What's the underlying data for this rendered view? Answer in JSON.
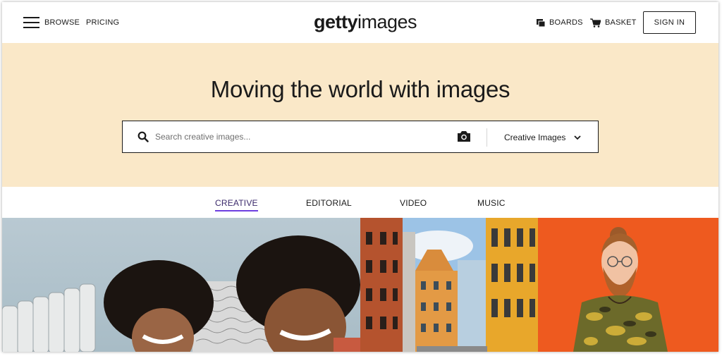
{
  "header": {
    "browse_label": "BROWSE",
    "pricing_label": "PRICING",
    "logo_bold": "getty",
    "logo_light": "images",
    "boards_label": "BOARDS",
    "basket_label": "BASKET",
    "signin_label": "SIGN IN"
  },
  "hero": {
    "title": "Moving the world with images",
    "search_placeholder": "Search creative images...",
    "search_value": "",
    "type_selected": "Creative Images",
    "background_color": "#fae8c8"
  },
  "tabs": [
    {
      "label": "CREATIVE",
      "active": true
    },
    {
      "label": "EDITORIAL",
      "active": false
    },
    {
      "label": "VIDEO",
      "active": false
    },
    {
      "label": "MUSIC",
      "active": false
    }
  ],
  "icons": {
    "menu": "hamburger-menu-icon",
    "boards": "boards-icon",
    "basket": "shopping-cart-icon",
    "search": "search-icon",
    "camera": "camera-icon",
    "dropdown": "chevron-down-icon"
  },
  "colors": {
    "accent_underline": "#6d3fe0",
    "text": "#1a1a1a"
  }
}
